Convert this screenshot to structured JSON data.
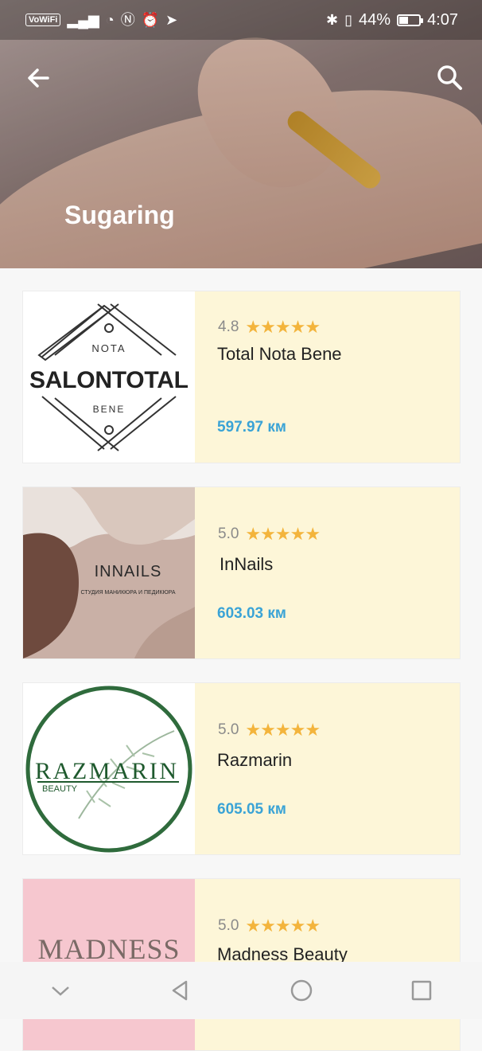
{
  "status": {
    "vowifi": "VoWiFi",
    "battery_text": "44%",
    "battery_fraction": 0.44,
    "time": "4:07"
  },
  "header": {
    "title": "Sugaring"
  },
  "salons": [
    {
      "rating": "4.8",
      "stars": "★★★★★",
      "name": "Total Nota Bene",
      "distance": "597.97 км",
      "logo": {
        "top": "NOTA",
        "main": "SALONTOTAL",
        "bottom": "BENE"
      }
    },
    {
      "rating": "5.0",
      "stars": "★★★★★",
      "name": "InNails",
      "distance": "603.03 км",
      "logo": {
        "main": "INNAILS",
        "sub": "СТУДИЯ МАНИКЮРА И ПЕДИКЮРА"
      }
    },
    {
      "rating": "5.0",
      "stars": "★★★★★",
      "name": "Razmarin",
      "distance": "605.05 км",
      "logo": {
        "main": "RAZMARIN",
        "sub": "BEAUTY"
      }
    },
    {
      "rating": "5.0",
      "stars": "★★★★★",
      "name": "Madness Beauty",
      "distance": "",
      "logo": {
        "main": "MADNESS"
      }
    }
  ],
  "colors": {
    "card_bg": "#fdf6d8",
    "star": "#f3b43c",
    "distance": "#3aa3d6"
  }
}
